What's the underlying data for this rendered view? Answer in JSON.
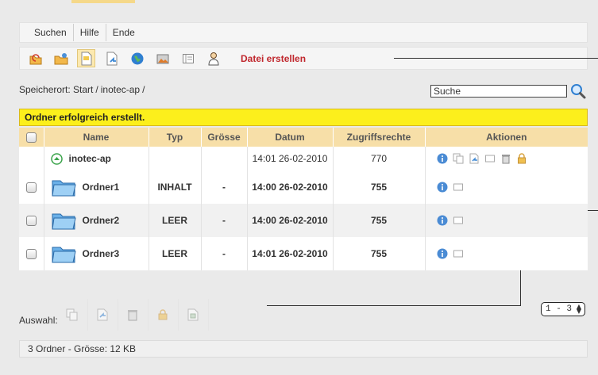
{
  "menu": {
    "items": [
      "Suchen",
      "Hilfe",
      "Ende"
    ]
  },
  "toolbar": {
    "status": "Datei erstellen",
    "buttons": [
      "up-folder-icon",
      "new-folder-icon",
      "new-file-icon",
      "upload-icon",
      "web-icon",
      "image-icon",
      "view-icon",
      "user-icon"
    ]
  },
  "location": {
    "label": "Speicherort:",
    "parts": [
      "Start",
      "inotec-ap",
      ""
    ]
  },
  "search": {
    "value": "Suche"
  },
  "notice": "Ordner erfolgreich erstellt.",
  "table": {
    "headers": [
      "",
      "Name",
      "Typ",
      "Grösse",
      "Datum",
      "Zugriffsrechte",
      "Aktionen"
    ],
    "parent": {
      "name": "inotec-ap",
      "date": "14:01 26-02-2010",
      "perms": "770"
    },
    "rows": [
      {
        "name": "Ordner1",
        "type": "INHALT",
        "size": "-",
        "date": "14:00 26-02-2010",
        "perms": "755"
      },
      {
        "name": "Ordner2",
        "type": "LEER",
        "size": "-",
        "date": "14:00 26-02-2010",
        "perms": "755"
      },
      {
        "name": "Ordner3",
        "type": "LEER",
        "size": "-",
        "date": "14:01 26-02-2010",
        "perms": "755"
      }
    ]
  },
  "selection": {
    "label": "Auswahl:"
  },
  "pager": {
    "value": "1 - 3"
  },
  "footer": "3 Ordner - Grösse: 12 KB",
  "colors": {
    "accent": "#f7dfa8",
    "notice": "#fcef1c",
    "status": "#c0272d"
  }
}
